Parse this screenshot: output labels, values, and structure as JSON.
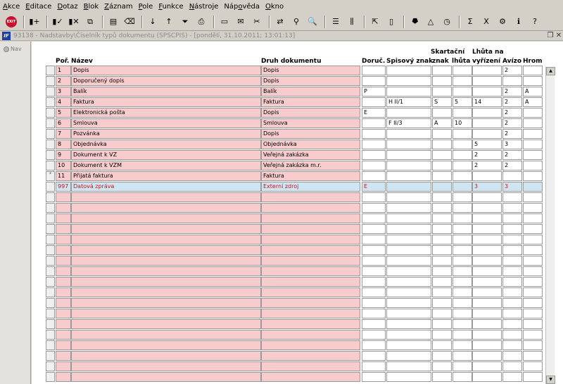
{
  "menu": [
    {
      "pre": "",
      "acc": "A",
      "post": "kce"
    },
    {
      "pre": "",
      "acc": "E",
      "post": "ditace"
    },
    {
      "pre": "",
      "acc": "D",
      "post": "otaz"
    },
    {
      "pre": "",
      "acc": "B",
      "post": "lok"
    },
    {
      "pre": "",
      "acc": "Z",
      "post": "áznam"
    },
    {
      "pre": "",
      "acc": "P",
      "post": "ole"
    },
    {
      "pre": "",
      "acc": "F",
      "post": "unkce"
    },
    {
      "pre": "",
      "acc": "N",
      "post": "ástroje"
    },
    {
      "pre": "Náp",
      "acc": "o",
      "post": "věda"
    },
    {
      "pre": "",
      "acc": "O",
      "post": "kno"
    }
  ],
  "toolbar": {
    "exit_label": "EXIT",
    "icons": [
      "insert-record-icon",
      "save-icon",
      "delete-record-icon",
      "copy-icon",
      "paste-icon",
      "clear-icon",
      "sort-ascending-icon",
      "sort-descending-icon",
      "filter-icon",
      "print-icon",
      "print-preview-icon",
      "mail-icon",
      "cut-icon",
      "paste-special-icon",
      "find-icon",
      "zoom-icon",
      "list-icon",
      "columns-icon",
      "export-icon",
      "import-icon",
      "tree-icon",
      "triangle-icon",
      "calculator-icon",
      "sum-icon",
      "excel-icon",
      "settings-icon",
      "info-icon",
      "help-icon"
    ],
    "glyphs": [
      "▮+",
      "▮✓",
      "▮✕",
      "⧉",
      "▤",
      "⌫",
      "↓",
      "↑",
      "⏷",
      "⎙",
      "▭",
      "✉",
      "✂",
      "⇄",
      "⚲",
      "🔍",
      "☰",
      "⫼",
      "⇱",
      "▯",
      "⯂",
      "△",
      "◷",
      "Σ",
      "X",
      "⚙",
      "ℹ",
      "?"
    ]
  },
  "window": {
    "title": "93138 - Nadstavby\\Číselník typů dokumentu (SPSCPIS) - [pondělí, 31.10.2011; 13:01:13]",
    "restore_glyph": "❐",
    "close_glyph": "✕"
  },
  "nav": {
    "label": "Nav"
  },
  "table": {
    "headers": {
      "por": "Poř.",
      "nazev": "Název",
      "druh": "Druh dokumentu",
      "doruc": "Doruč.",
      "spisovy": "Spisový znak",
      "skartacni": "Skartační",
      "znak": "znak",
      "lhuta": "lhůta",
      "lhuta_na": "Lhůta na",
      "vyrizeni": "vyřízení",
      "avizo": "Avízo",
      "hrom": "Hrom"
    },
    "rows": [
      {
        "por": "1",
        "nazev": "Dopis",
        "druh": "Dopis",
        "doruc": "",
        "spisovy": "",
        "skart_znak": "",
        "skart_lhuta": "",
        "lhuta_vyr": "",
        "avizo": "2",
        "hrom": "",
        "marker": ""
      },
      {
        "por": "2",
        "nazev": "Doporučený dopis",
        "druh": "Dopis",
        "doruc": "",
        "spisovy": "",
        "skart_znak": "",
        "skart_lhuta": "",
        "lhuta_vyr": "",
        "avizo": "",
        "hrom": "",
        "marker": ""
      },
      {
        "por": "3",
        "nazev": "Balík",
        "druh": "Balík",
        "doruc": "P",
        "spisovy": "",
        "skart_znak": "",
        "skart_lhuta": "",
        "lhuta_vyr": "",
        "avizo": "2",
        "hrom": "A",
        "marker": ""
      },
      {
        "por": "4",
        "nazev": "Faktura",
        "druh": "Faktura",
        "doruc": "",
        "spisovy": "H II/1",
        "skart_znak": "S",
        "skart_lhuta": "5",
        "lhuta_vyr": "14",
        "avizo": "2",
        "hrom": "A",
        "marker": ""
      },
      {
        "por": "5",
        "nazev": "Elektronická pošta",
        "druh": "Dopis",
        "doruc": "E",
        "spisovy": "",
        "skart_znak": "",
        "skart_lhuta": "",
        "lhuta_vyr": "",
        "avizo": "2",
        "hrom": "",
        "marker": ""
      },
      {
        "por": "6",
        "nazev": "Smlouva",
        "druh": "Smlouva",
        "doruc": "",
        "spisovy": "F II/3",
        "skart_znak": "A",
        "skart_lhuta": "10",
        "lhuta_vyr": "",
        "avizo": "2",
        "hrom": "",
        "marker": ""
      },
      {
        "por": "7",
        "nazev": "Pozvánka",
        "druh": "Dopis",
        "doruc": "",
        "spisovy": "",
        "skart_znak": "",
        "skart_lhuta": "",
        "lhuta_vyr": "",
        "avizo": "2",
        "hrom": "",
        "marker": ""
      },
      {
        "por": "8",
        "nazev": "Objednávka",
        "druh": "Objednávka",
        "doruc": "",
        "spisovy": "",
        "skart_znak": "",
        "skart_lhuta": "",
        "lhuta_vyr": "5",
        "avizo": "3",
        "hrom": "",
        "marker": ""
      },
      {
        "por": "9",
        "nazev": "Dokument k VZ",
        "druh": "Veřejná zakázka",
        "doruc": "",
        "spisovy": "",
        "skart_znak": "",
        "skart_lhuta": "",
        "lhuta_vyr": "2",
        "avizo": "2",
        "hrom": "",
        "marker": ""
      },
      {
        "por": "10",
        "nazev": "Dokument k VZM",
        "druh": "Veřejná zakázka m.r.",
        "doruc": "",
        "spisovy": "",
        "skart_znak": "",
        "skart_lhuta": "",
        "lhuta_vyr": "2",
        "avizo": "2",
        "hrom": "",
        "marker": ""
      },
      {
        "por": "11",
        "nazev": "Přijatá faktura",
        "druh": "Faktura",
        "doruc": "",
        "spisovy": "",
        "skart_znak": "",
        "skart_lhuta": "",
        "lhuta_vyr": "",
        "avizo": "",
        "hrom": "",
        "marker": "*"
      },
      {
        "por": "997",
        "nazev": "Datová zpráva",
        "druh": "Externí zdroj",
        "doruc": "E",
        "spisovy": "",
        "skart_znak": "",
        "skart_lhuta": "",
        "lhuta_vyr": "3",
        "avizo": "3",
        "hrom": "",
        "marker": "",
        "selected": true
      }
    ],
    "empty_rows": 18
  }
}
